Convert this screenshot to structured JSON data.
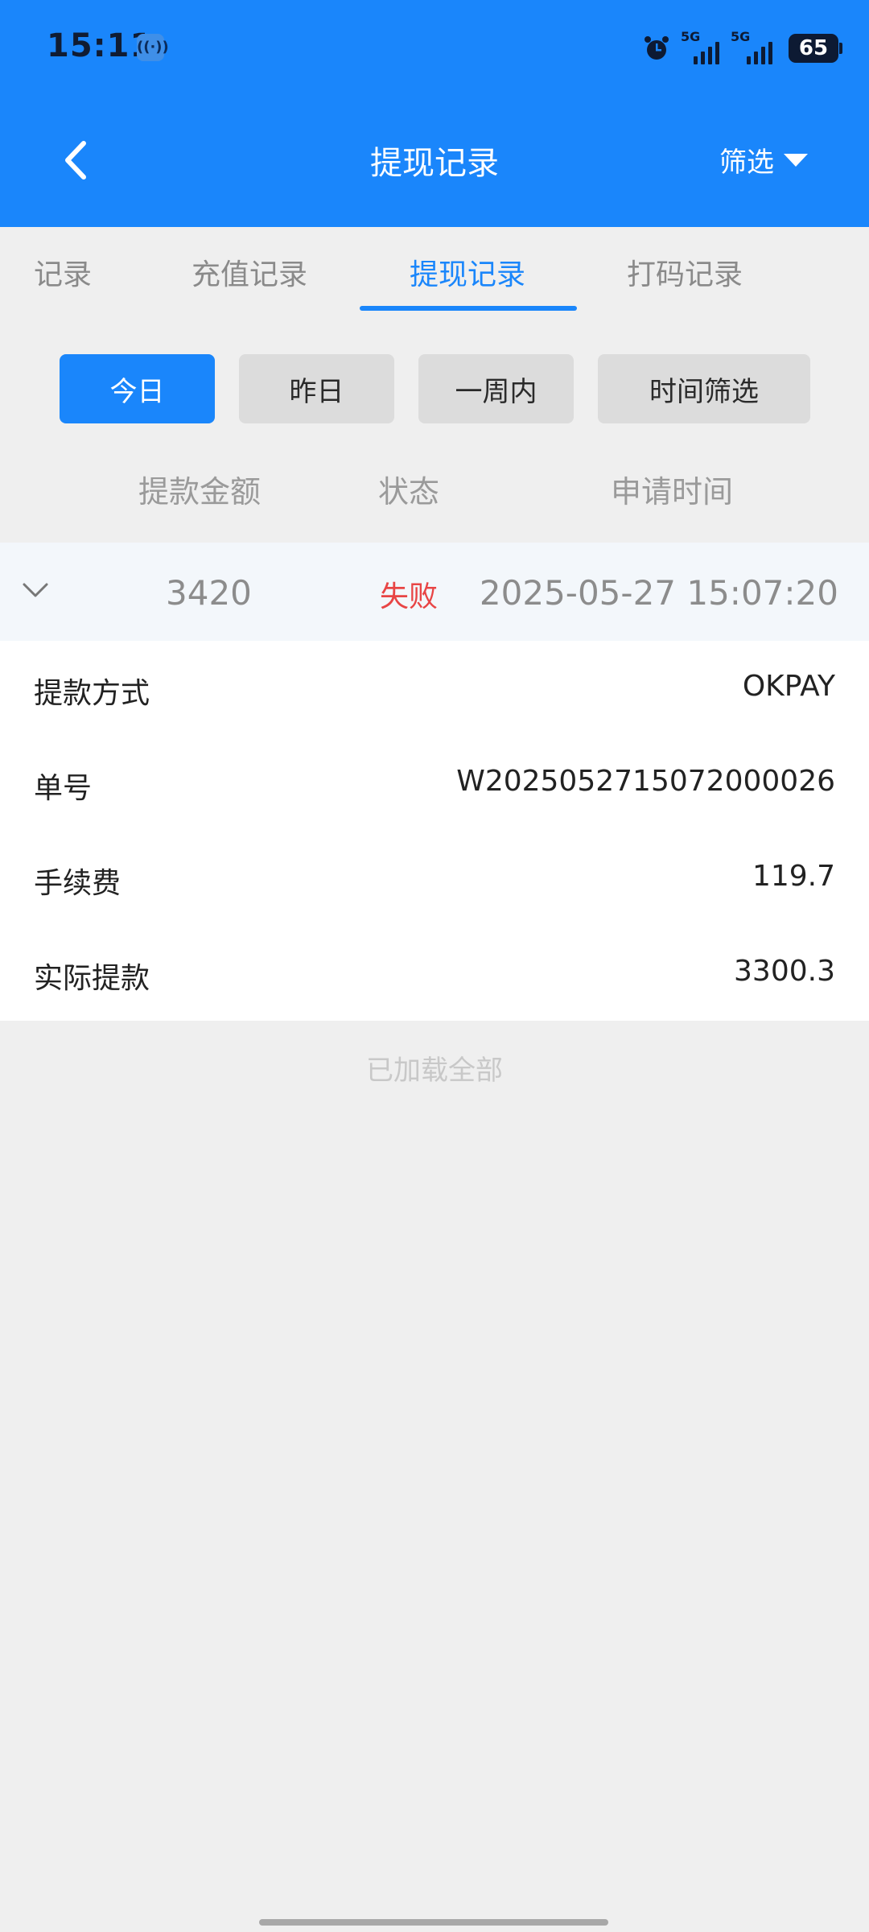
{
  "status_bar": {
    "time": "15:11",
    "network_1": "5G",
    "network_2": "5G",
    "battery": "65",
    "icons": [
      "hotspot-icon",
      "alarm-icon",
      "signal-icon",
      "battery-icon"
    ]
  },
  "header": {
    "title": "提现记录",
    "filter_label": "筛选",
    "back_icon": "chevron-left-icon",
    "filter_icon": "triangle-down-icon",
    "background": "#1a86fb"
  },
  "tabs": [
    {
      "label": "记录",
      "active": false
    },
    {
      "label": "充值记录",
      "active": false
    },
    {
      "label": "提现记录",
      "active": true
    },
    {
      "label": "打码记录",
      "active": false
    }
  ],
  "date_filters": [
    {
      "label": "今日",
      "active": true
    },
    {
      "label": "昨日",
      "active": false
    },
    {
      "label": "一周内",
      "active": false
    },
    {
      "label": "时间筛选",
      "active": false
    }
  ],
  "columns": {
    "amount": "提款金额",
    "status": "状态",
    "time": "申请时间"
  },
  "record": {
    "expanded": true,
    "amount": "3420",
    "status": "失败",
    "status_color": "#e84545",
    "time": "2025-05-27 15:07:20",
    "details": [
      {
        "label": "提款方式",
        "value": "OKPAY"
      },
      {
        "label": "单号",
        "value": "W2025052715072000026"
      },
      {
        "label": "手续费",
        "value": "119.7"
      },
      {
        "label": "实际提款",
        "value": "3300.3"
      }
    ]
  },
  "footer": {
    "text": "已加载全部"
  }
}
